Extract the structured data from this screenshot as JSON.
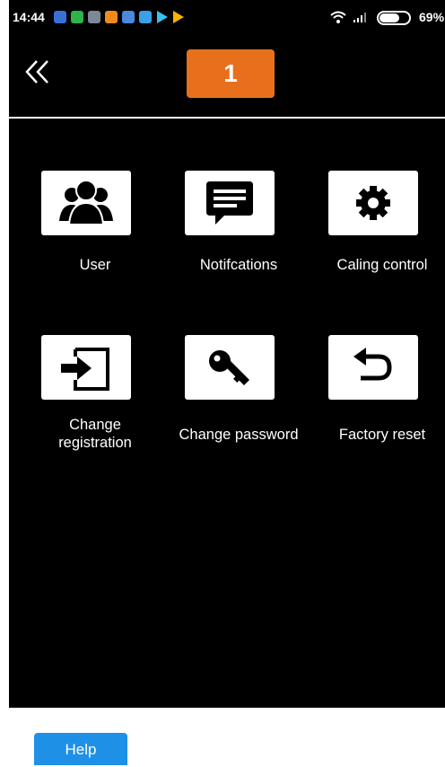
{
  "status_bar": {
    "time": "14:44",
    "battery_percent": "69%",
    "icons": [
      "shield-app-icon",
      "phone-app-icon",
      "gallery-app-icon",
      "settings-app-icon",
      "photos-app-icon",
      "browser-app-icon",
      "play-store-icon",
      "play-store-icon"
    ],
    "signal": "wifi-signal-icon"
  },
  "header": {
    "back_icon": "double-chevron-left-icon",
    "page_number": "1",
    "accent_color": "#e8701d"
  },
  "menu": {
    "items": [
      {
        "label": "User",
        "icon": "users-icon"
      },
      {
        "label": "Notifcations",
        "icon": "message-icon"
      },
      {
        "label": "Caling control",
        "icon": "gear-icon"
      },
      {
        "label_line1": "Change",
        "label_line2": "registration",
        "icon": "enter-icon"
      },
      {
        "label": "Change password",
        "icon": "key-icon"
      },
      {
        "label": "Factory reset",
        "icon": "undo-icon"
      }
    ]
  },
  "footer": {
    "help_label": "Help",
    "help_color": "#1e90e6"
  }
}
